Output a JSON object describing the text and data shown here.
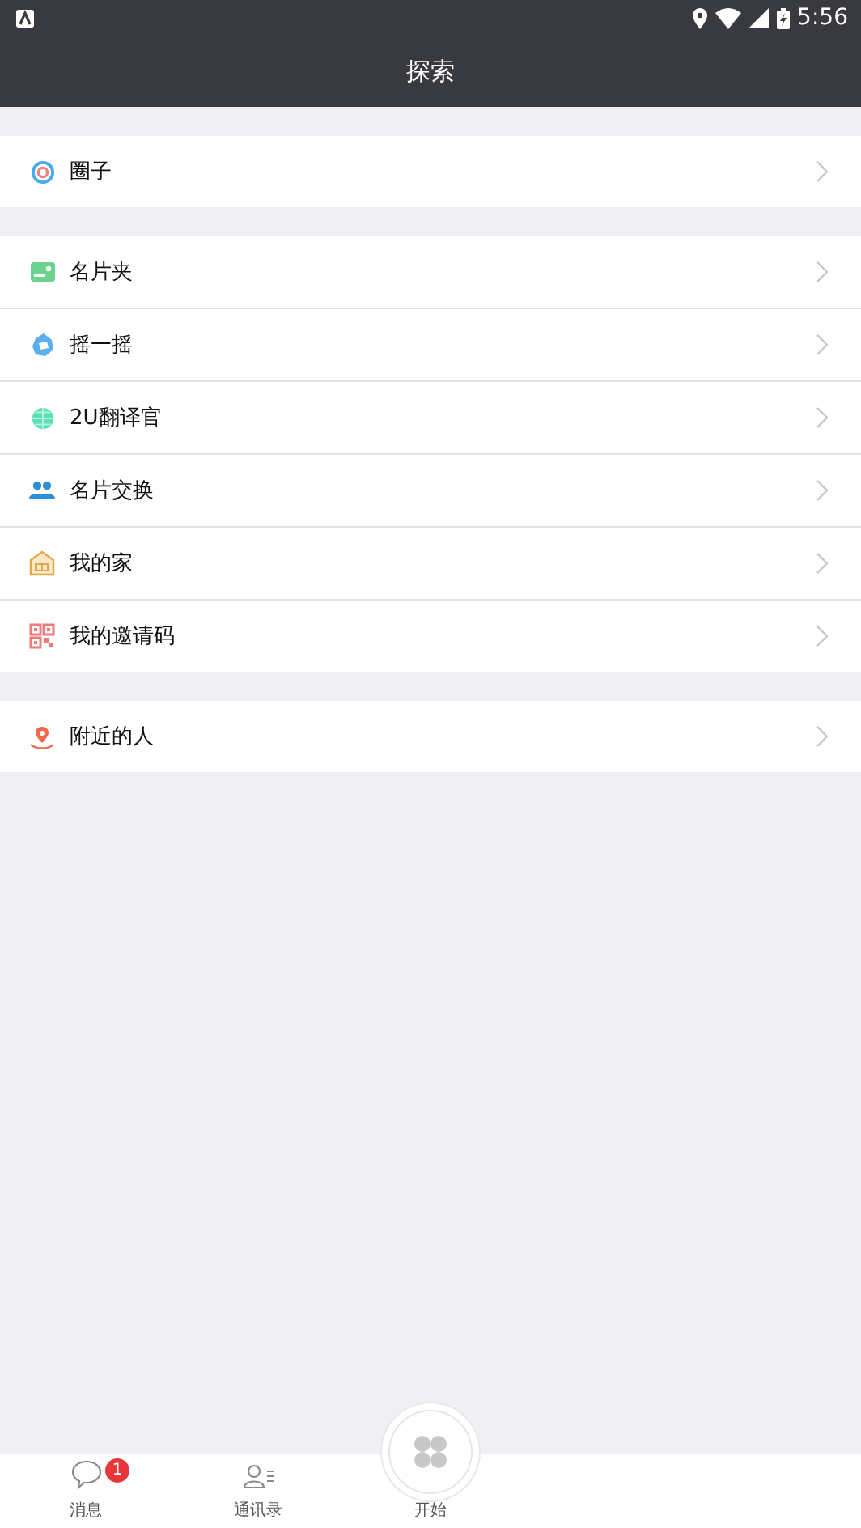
{
  "status_bar": {
    "time": "5:56"
  },
  "header": {
    "title": "探索"
  },
  "groups": [
    {
      "items": [
        {
          "kind": "circle",
          "label": "圈子"
        }
      ]
    },
    {
      "items": [
        {
          "kind": "card",
          "label": "名片夹"
        },
        {
          "kind": "shake",
          "label": "摇一摇"
        },
        {
          "kind": "globe",
          "label": "2U翻译官"
        },
        {
          "kind": "people",
          "label": "名片交换"
        },
        {
          "kind": "home",
          "label": "我的家"
        },
        {
          "kind": "qr",
          "label": "我的邀请码"
        }
      ]
    },
    {
      "items": [
        {
          "kind": "pin",
          "label": "附近的人"
        }
      ]
    }
  ],
  "tab_bar": [
    {
      "kind": "chat",
      "label": "消息",
      "badge": "1"
    },
    {
      "kind": "contacts",
      "label": "通讯录"
    },
    {
      "kind": "start",
      "label": "开始"
    }
  ]
}
